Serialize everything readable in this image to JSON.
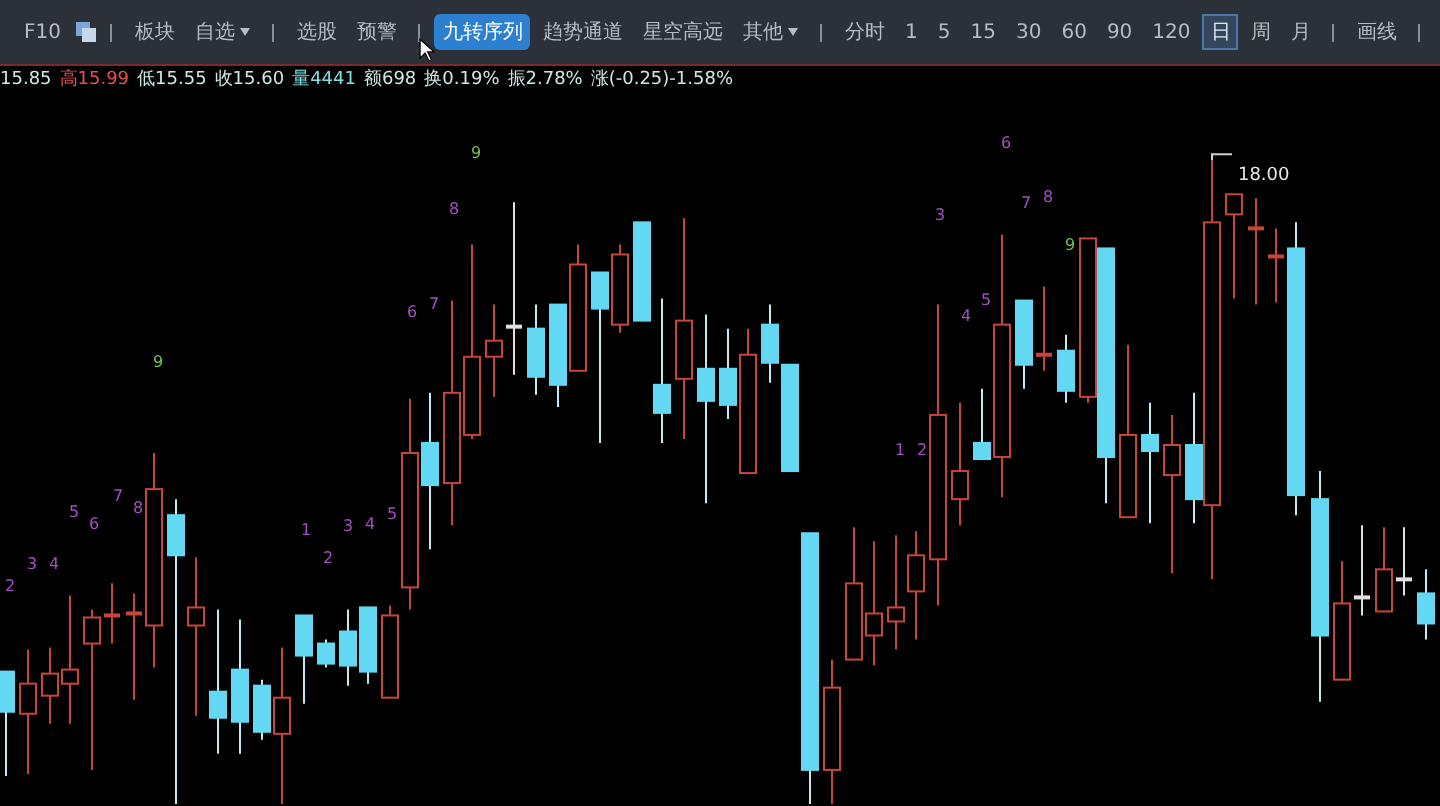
{
  "toolbar": {
    "items": [
      {
        "kind": "text",
        "label": "F10",
        "selected": false
      },
      {
        "kind": "icon"
      },
      {
        "kind": "separator"
      },
      {
        "kind": "text",
        "label": "板块",
        "selected": false
      },
      {
        "kind": "dropdown",
        "label": "自选",
        "selected": false
      },
      {
        "kind": "separator"
      },
      {
        "kind": "text",
        "label": "选股",
        "selected": false
      },
      {
        "kind": "text",
        "label": "预警",
        "selected": false
      },
      {
        "kind": "separator"
      },
      {
        "kind": "text",
        "label": "九转序列",
        "selected": true
      },
      {
        "kind": "text",
        "label": "趋势通道",
        "selected": false
      },
      {
        "kind": "text",
        "label": "星空高远",
        "selected": false
      },
      {
        "kind": "dropdown",
        "label": "其他",
        "selected": false
      },
      {
        "kind": "separator"
      },
      {
        "kind": "text",
        "label": "分时",
        "selected": false
      },
      {
        "kind": "text",
        "label": "1",
        "selected": false
      },
      {
        "kind": "text",
        "label": "5",
        "selected": false
      },
      {
        "kind": "text",
        "label": "15",
        "selected": false
      },
      {
        "kind": "text",
        "label": "30",
        "selected": false
      },
      {
        "kind": "text",
        "label": "60",
        "selected": false
      },
      {
        "kind": "text",
        "label": "90",
        "selected": false
      },
      {
        "kind": "text",
        "label": "120",
        "selected": false
      },
      {
        "kind": "text",
        "label": "日",
        "selected": true
      },
      {
        "kind": "text",
        "label": "周",
        "selected": false
      },
      {
        "kind": "text",
        "label": "月",
        "selected": false
      },
      {
        "kind": "separator"
      },
      {
        "kind": "text",
        "label": "画线",
        "selected": false
      },
      {
        "kind": "separator"
      }
    ]
  },
  "quote": [
    {
      "text": "15.85",
      "color": "#cfe6e6"
    },
    {
      "text": "高15.99",
      "color": "#e05050"
    },
    {
      "text": "低15.55",
      "color": "#cfe6e6"
    },
    {
      "text": "收15.60",
      "color": "#cfe6e6"
    },
    {
      "text": "量4441",
      "color": "#7fe0e0"
    },
    {
      "text": "额698",
      "color": "#cfe6e6"
    },
    {
      "text": "换0.19%",
      "color": "#cfe6e6"
    },
    {
      "text": "振2.78%",
      "color": "#cfe6e6"
    },
    {
      "text": "涨(-0.25)-1.58%",
      "color": "#cfe6e6"
    }
  ],
  "chart": {
    "count_labels": [
      {
        "text": "2",
        "color": "#a050c0"
      },
      {
        "text": "3",
        "color": "#a050c0"
      },
      {
        "text": "4",
        "color": "#a050c0"
      },
      {
        "text": "5",
        "color": "#a050c0"
      },
      {
        "text": "6",
        "color": "#a050c0"
      },
      {
        "text": "7",
        "color": "#a050c0"
      },
      {
        "text": "8",
        "color": "#a050c0"
      },
      {
        "text": "9",
        "color": "#6fc04a"
      },
      {
        "text": "1",
        "color": "#a050c0"
      },
      {
        "text": "2",
        "color": "#a050c0"
      },
      {
        "text": "3",
        "color": "#a050c0"
      },
      {
        "text": "4",
        "color": "#a050c0"
      },
      {
        "text": "5",
        "color": "#a050c0"
      },
      {
        "text": "6",
        "color": "#a050c0"
      },
      {
        "text": "7",
        "color": "#a050c0"
      },
      {
        "text": "8",
        "color": "#a050c0"
      },
      {
        "text": "9",
        "color": "#6fc04a"
      },
      {
        "text": "1",
        "color": "#a050c0"
      },
      {
        "text": "2",
        "color": "#a050c0"
      },
      {
        "text": "3",
        "color": "#a050c0"
      },
      {
        "text": "4",
        "color": "#a050c0"
      },
      {
        "text": "5",
        "color": "#a050c0"
      },
      {
        "text": "6",
        "color": "#a050c0"
      },
      {
        "text": "7",
        "color": "#a050c0"
      },
      {
        "text": "8",
        "color": "#a050c0"
      },
      {
        "text": "9",
        "color": "#6fc04a"
      }
    ],
    "high_label": "18.00"
  }
}
